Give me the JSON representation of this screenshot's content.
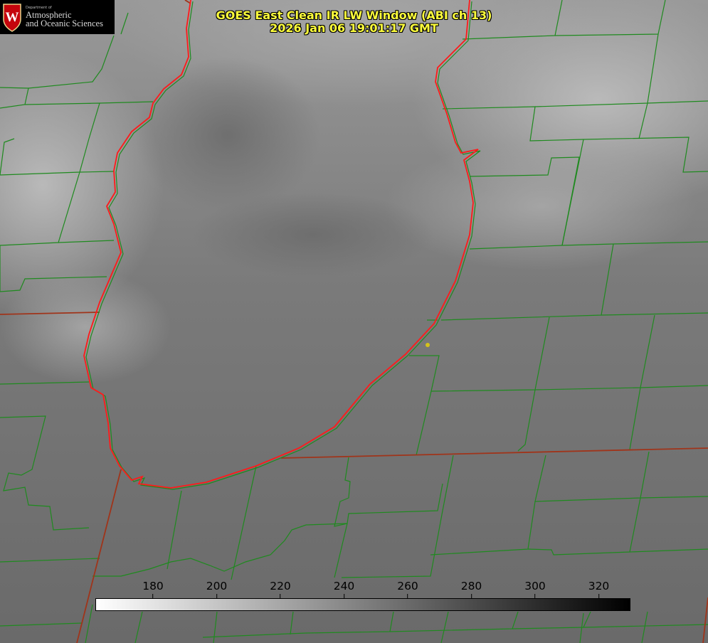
{
  "header": {
    "title_line1": "GOES East Clean IR LW Window (ABI ch 13)",
    "title_line2": "2026 Jan 06 19:01:17 GMT"
  },
  "logo": {
    "department": "Department of",
    "line1": "Atmospheric",
    "line2": "and Oceanic Sciences",
    "crest_letter": "W"
  },
  "colorbar": {
    "ticks": [
      "180",
      "200",
      "220",
      "240",
      "260",
      "280",
      "300",
      "320"
    ],
    "gradient_from": "#ffffff",
    "gradient_to": "#000000"
  },
  "map": {
    "feature_colors": {
      "state_borders": "#a0341a",
      "county_lines": "#1f8a1f",
      "lake_shoreline": "#ff1a1a",
      "point_marker": "#d4c21a"
    }
  }
}
